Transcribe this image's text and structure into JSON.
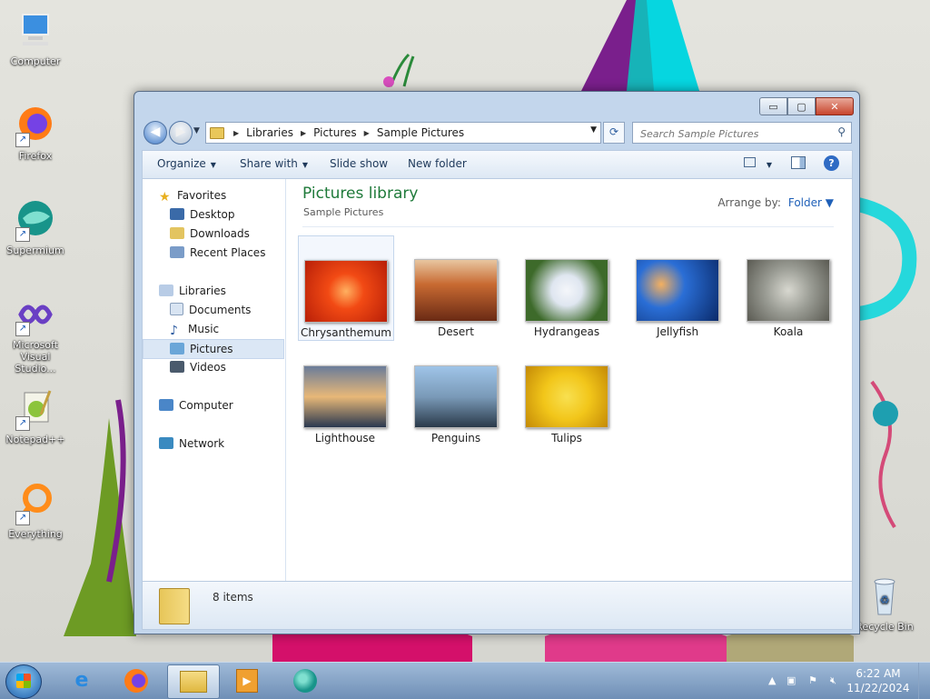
{
  "desktop": {
    "icons": [
      {
        "label": "Computer",
        "icon": "computer-icon"
      },
      {
        "label": "Firefox",
        "icon": "firefox-icon"
      },
      {
        "label": "Supermium",
        "icon": "supermium-icon"
      },
      {
        "label": "Microsoft Visual Studio...",
        "icon": "visual-studio-icon"
      },
      {
        "label": "Notepad++",
        "icon": "notepadpp-icon"
      },
      {
        "label": "Everything",
        "icon": "everything-icon"
      },
      {
        "label": "Recycle Bin",
        "icon": "recycle-bin-icon"
      }
    ]
  },
  "window": {
    "controls": {
      "minimize": "▭",
      "maximize": "▢",
      "close": "✕"
    },
    "address": {
      "segments": [
        "Libraries",
        "Pictures",
        "Sample Pictures"
      ]
    },
    "search": {
      "placeholder": "Search Sample Pictures"
    },
    "toolbar": {
      "organize": "Organize",
      "share_with": "Share with",
      "slide_show": "Slide show",
      "new_folder": "New folder"
    },
    "navpane": {
      "favorites": "Favorites",
      "desktop": "Desktop",
      "downloads": "Downloads",
      "recent_places": "Recent Places",
      "libraries": "Libraries",
      "documents": "Documents",
      "music": "Music",
      "pictures": "Pictures",
      "videos": "Videos",
      "computer": "Computer",
      "network": "Network"
    },
    "library": {
      "title": "Pictures library",
      "subtitle": "Sample Pictures",
      "arrange_label": "Arrange by:",
      "arrange_value": "Folder"
    },
    "items": [
      {
        "name": "Chrysanthemum",
        "colors": [
          "#f24a14",
          "#b81f08"
        ]
      },
      {
        "name": "Desert",
        "colors": [
          "#c86a32",
          "#6a2a14"
        ]
      },
      {
        "name": "Hydrangeas",
        "colors": [
          "#dfe6f0",
          "#3d6a2a"
        ]
      },
      {
        "name": "Jellyfish",
        "colors": [
          "#2a6ed6",
          "#0a2a6a"
        ]
      },
      {
        "name": "Koala",
        "colors": [
          "#9a9c94",
          "#5a5a52"
        ]
      },
      {
        "name": "Lighthouse",
        "colors": [
          "#e8b878",
          "#2a3850"
        ]
      },
      {
        "name": "Penguins",
        "colors": [
          "#9fc4e8",
          "#2a3a4a"
        ]
      },
      {
        "name": "Tulips",
        "colors": [
          "#f2c61a",
          "#c48a06"
        ]
      }
    ],
    "status": {
      "count": "8 items"
    }
  },
  "taskbar": {
    "apps": [
      "internet-explorer-icon",
      "firefox-icon",
      "file-explorer-icon",
      "media-player-icon",
      "supermium-icon"
    ],
    "clock": {
      "time": "6:22 AM",
      "date": "11/22/2024"
    }
  }
}
